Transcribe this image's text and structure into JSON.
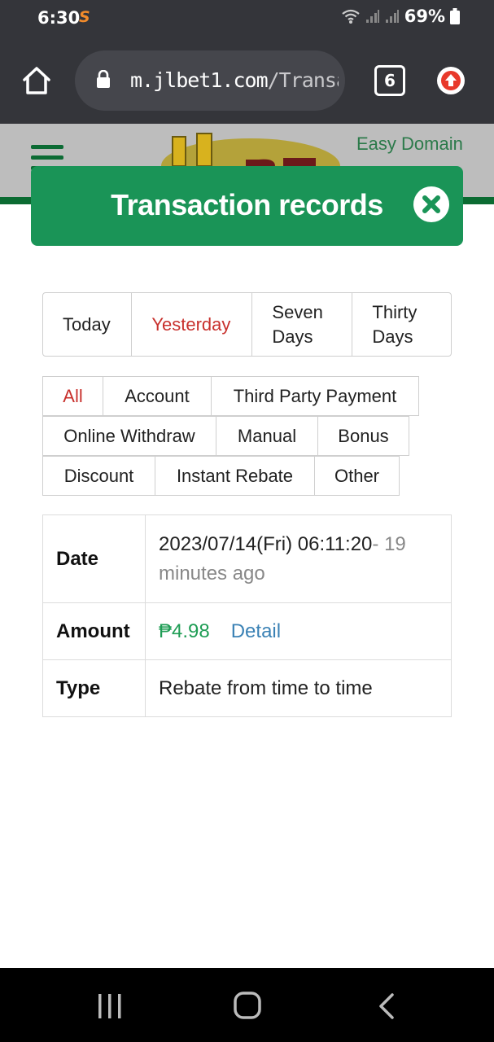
{
  "status_bar": {
    "time": "6:30",
    "app_badge": "S",
    "battery": "69%"
  },
  "browser": {
    "url_host": "m.jlbet1.com",
    "url_path": "/Transac",
    "tab_count": "6"
  },
  "site": {
    "header_link": "Easy Domain"
  },
  "modal": {
    "title": "Transaction records"
  },
  "periods": [
    {
      "label": "Today",
      "active": false
    },
    {
      "label": "Yesterday",
      "active": true
    },
    {
      "label": "Seven Days",
      "active": false
    },
    {
      "label": "Thirty Days",
      "active": false
    }
  ],
  "filters": [
    {
      "label": "All",
      "active": true
    },
    {
      "label": "Account",
      "active": false
    },
    {
      "label": "Third Party Payment",
      "active": false
    },
    {
      "label": "Online Withdraw",
      "active": false
    },
    {
      "label": "Manual",
      "active": false
    },
    {
      "label": "Bonus",
      "active": false
    },
    {
      "label": "Discount",
      "active": false
    },
    {
      "label": "Instant Rebate",
      "active": false
    },
    {
      "label": "Other",
      "active": false
    }
  ],
  "record": {
    "date_label": "Date",
    "date_value": "2023/07/14(Fri) 06:11:20",
    "date_ago": "- 19 minutes ago",
    "amount_label": "Amount",
    "amount_value": "₱4.98",
    "detail_label": "Detail",
    "type_label": "Type",
    "type_value": "Rebate from time to time"
  },
  "colors": {
    "accent_green": "#1a9457",
    "active_red": "#c8312d",
    "amount_green": "#1f9d55",
    "link_blue": "#3b82b5"
  }
}
